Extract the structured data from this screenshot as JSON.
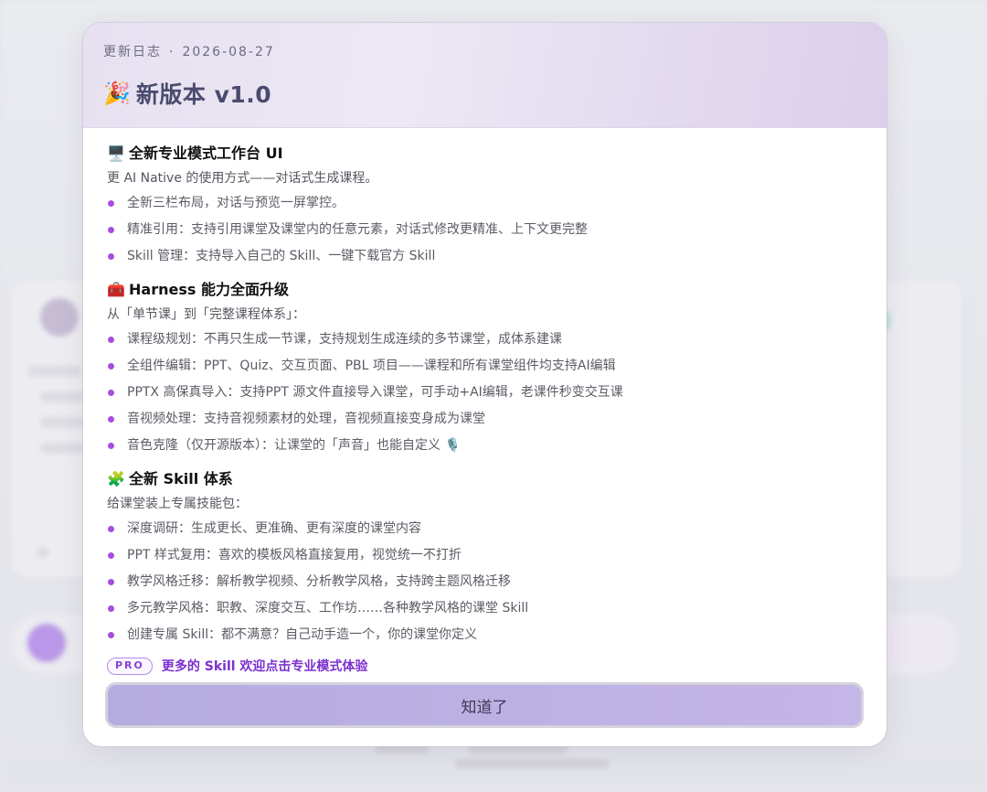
{
  "colors": {
    "accent": "#a54ee0",
    "header_gradient_start": "#e6e0f0",
    "header_gradient_end": "#dccfeb",
    "button_fill": "#bcb0e3",
    "title_text": "#4a4b6e"
  },
  "modal": {
    "tag_label": "更新日志",
    "tag_separator": "·",
    "tag_date": "2026-08-27",
    "title_icon": "🎉",
    "title": "新版本 v1.0",
    "sections": [
      {
        "icon": "🖥️",
        "icon_name": "monitor-icon",
        "title": "全新专业模式工作台 UI",
        "subtitle": "更 AI Native 的使用方式——对话式生成课程。",
        "items": [
          "全新三栏布局，对话与预览一屏掌控。",
          "精准引用：支持引用课堂及课堂内的任意元素，对话式修改更精准、上下文更完整",
          "Skill 管理：支持导入自己的 Skill、一键下载官方 Skill"
        ]
      },
      {
        "icon": "🧰",
        "icon_name": "toolbox-icon",
        "title": "Harness 能力全面升级",
        "subtitle": "从「单节课」到「完整课程体系」：",
        "items": [
          "课程级规划：不再只生成一节课，支持规划生成连续的多节课堂，成体系建课",
          "全组件编辑：PPT、Quiz、交互页面、PBL 项目——课程和所有课堂组件均支持AI编辑",
          "PPTX 高保真导入：支持PPT 源文件直接导入课堂，可手动+AI编辑，老课件秒变交互课",
          "音视频处理：支持音视频素材的处理，音视频直接变身成为课堂",
          "音色克隆（仅开源版本）：让课堂的「声音」也能自定义 🎙️"
        ]
      },
      {
        "icon": "🧩",
        "icon_name": "puzzle-icon",
        "title": "全新 Skill 体系",
        "subtitle": "给课堂装上专属技能包：",
        "items": [
          "深度调研：生成更长、更准确、更有深度的课堂内容",
          "PPT 样式复用：喜欢的模板风格直接复用，视觉统一不打折",
          "教学风格迁移：解析教学视频、分析教学风格，支持跨主题风格迁移",
          "多元教学风格：职教、深度交互、工作坊……各种教学风格的课堂 Skill",
          "创建专属 Skill：都不满意？自己动手造一个，你的课堂你定义"
        ]
      }
    ],
    "pro_badge": "PRO",
    "pro_link": "更多的 Skill 欢迎点击专业模式体验",
    "ack_button": "知道了"
  }
}
